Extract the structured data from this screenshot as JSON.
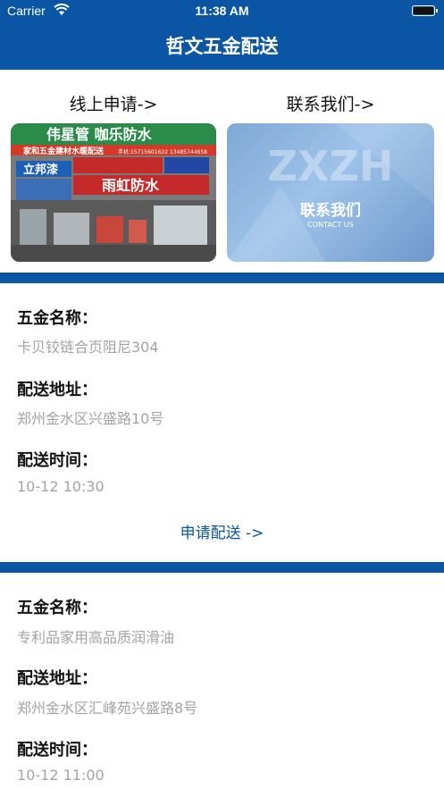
{
  "status_bar": {
    "carrier": "Carrier",
    "time": "11:38 AM"
  },
  "header": {
    "title": "哲文五金配送"
  },
  "entries": {
    "apply_label": "线上申请->",
    "contact_label": "联系我们->",
    "store_sign_1": "伟星管 咖乐防水",
    "store_sign_2": "家和五金建材水暖配送",
    "store_phone_1": "手机:15715601622",
    "store_phone_2": "13485744658",
    "store_sign_3": "立邦漆",
    "store_sign_4": "雨虹防水",
    "contact_title": "联系我们",
    "contact_sub": "CONTACT US",
    "contact_logo": "ZXZH"
  },
  "orders": [
    {
      "name_label": "五金名称：",
      "name": "卡贝铰链合页阻尼304",
      "addr_label": "配送地址：",
      "addr": "郑州金水区兴盛路10号",
      "time_label": "配送时间：",
      "time": "10-12 10:30",
      "action": "申请配送 ->"
    },
    {
      "name_label": "五金名称：",
      "name": "专利品家用高品质润滑油",
      "addr_label": "配送地址：",
      "addr": "郑州金水区汇峰苑兴盛路8号",
      "time_label": "配送时间：",
      "time": "10-12 11:00"
    }
  ],
  "colors": {
    "brand": "#0a56a4",
    "muted_text": "#a3a3a3"
  }
}
